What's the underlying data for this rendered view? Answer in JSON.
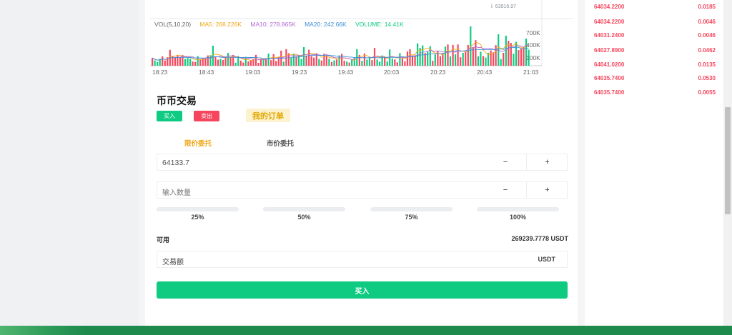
{
  "chart": {
    "last_price_flag": "⇂ 63916.97",
    "vol": "VOL(5,10,20)",
    "ma5": "MA5: 268.226K",
    "ma10": "MA10: 278.865K",
    "ma20": "MA20: 242.66K",
    "volume": "VOLUME: 14.41K",
    "yaxis": [
      "700K",
      "400K",
      "100K"
    ],
    "xaxis": [
      "18:23",
      "18:43",
      "19:03",
      "19:23",
      "19:43",
      "20:03",
      "20:23",
      "20:43",
      "21:03"
    ],
    "colors": {
      "vol": "#666666",
      "ma5": "#f0a818",
      "ma10": "#b36bd4",
      "ma20": "#3f8fd6",
      "volume": "#0ecb81"
    }
  },
  "trade": {
    "title": "币币交易",
    "buy_tab": "买入",
    "sell_tab": "卖出",
    "my_orders": "我的订单",
    "limit_tab": "限价委托",
    "market_tab": "市价委托",
    "price_value": "64133.7",
    "qty_placeholder": "输入数量",
    "minus": "−",
    "plus": "+",
    "percents": [
      "25%",
      "50%",
      "75%",
      "100%"
    ],
    "available_label": "可用",
    "available_value": "269239.7778 USDT",
    "amount_placeholder": "交易额",
    "amount_unit": "USDT",
    "submit": "买入"
  },
  "orderbook": [
    {
      "price": "64034.2200",
      "qty": "0.0185"
    },
    {
      "price": "64034.2200",
      "qty": "0.0046"
    },
    {
      "price": "64031.2400",
      "qty": "0.0046"
    },
    {
      "price": "64027.8900",
      "qty": "0.0462"
    },
    {
      "price": "64041.0200",
      "qty": "0.0135"
    },
    {
      "price": "64035.7400",
      "qty": "0.0530"
    },
    {
      "price": "64035.7400",
      "qty": "0.0055"
    }
  ],
  "colors": {
    "buy": "#0ecb81",
    "sell": "#f6465d",
    "accent": "#f0a818"
  }
}
